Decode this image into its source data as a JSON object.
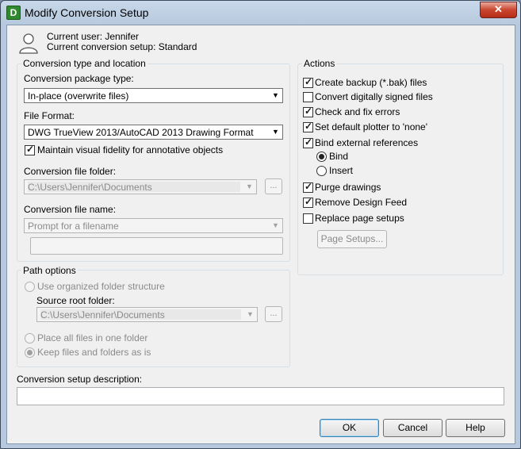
{
  "window": {
    "title": "Modify Conversion Setup",
    "icon_letter": "D",
    "close_glyph": "✕"
  },
  "header": {
    "current_user": "Current user: Jennifer",
    "current_setup": "Current conversion setup: Standard"
  },
  "conversion": {
    "group_title": "Conversion type and location",
    "package_type_label": "Conversion package type:",
    "package_type_value": "In-place (overwrite files)",
    "file_format_label": "File Format:",
    "file_format_value": "DWG TrueView 2013/AutoCAD 2013 Drawing Format",
    "fidelity_label": "Maintain visual fidelity for annotative objects",
    "fidelity_checked": true,
    "folder_label": "Conversion file folder:",
    "folder_value": "C:\\Users\\Jennifer\\Documents",
    "browse_label": "...",
    "file_name_label": "Conversion file name:",
    "file_name_value": "Prompt for a filename"
  },
  "path_options": {
    "group_title": "Path options",
    "organized_label": "Use organized folder structure",
    "source_root_label": "Source root folder:",
    "source_root_value": "C:\\Users\\Jennifer\\Documents",
    "browse_label": "...",
    "one_folder_label": "Place all files in one folder",
    "keep_label": "Keep files and folders as is",
    "selected": "keep"
  },
  "actions": {
    "group_title": "Actions",
    "create_backup": {
      "label": "Create backup (*.bak) files",
      "checked": true
    },
    "convert_signed": {
      "label": "Convert digitally signed files",
      "checked": false
    },
    "check_fix": {
      "label": "Check and fix errors",
      "checked": true
    },
    "default_plotter": {
      "label": "Set default plotter to 'none'",
      "checked": true
    },
    "bind_xrefs": {
      "label": "Bind external references",
      "checked": true
    },
    "bind_option": "Bind",
    "insert_option": "Insert",
    "bind_selected": "Bind",
    "purge": {
      "label": "Purge drawings",
      "checked": true
    },
    "remove_feed": {
      "label": "Remove Design Feed",
      "checked": true
    },
    "replace_setups": {
      "label": "Replace page setups",
      "checked": false
    },
    "page_setups_button": "Page Setups..."
  },
  "description": {
    "label": "Conversion setup description:",
    "value": ""
  },
  "buttons": {
    "ok": "OK",
    "cancel": "Cancel",
    "help": "Help"
  },
  "icons": {
    "dropdown": "▼",
    "check": "✓"
  }
}
